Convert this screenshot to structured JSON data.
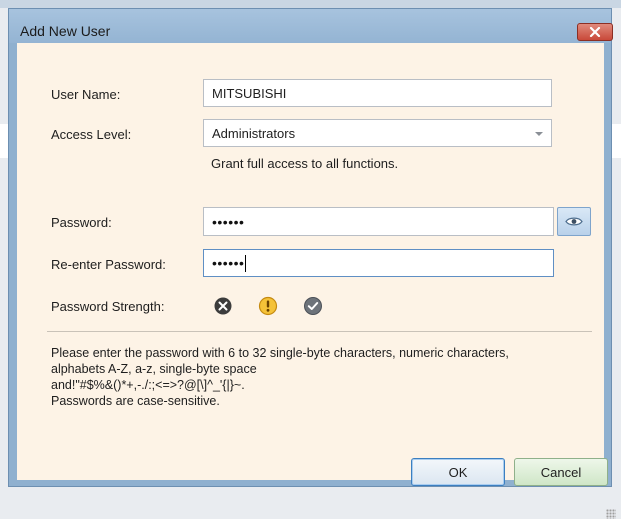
{
  "window": {
    "title": "Add New User",
    "close_icon": "close-x-icon"
  },
  "form": {
    "user_name_label": "User Name:",
    "user_name_value": "MITSUBISHI",
    "access_level_label": "Access Level:",
    "access_level_value": "Administrators",
    "access_level_hint": "Grant full access to all functions.",
    "password_label": "Password:",
    "password_value": "••••••",
    "reenter_label": "Re-enter Password:",
    "reenter_value": "••••••",
    "show_password_icon": "eye-icon",
    "strength_label": "Password Strength:",
    "strength_icons": [
      "x-circle-icon",
      "warning-icon",
      "check-circle-icon"
    ]
  },
  "info_lines": [
    "Please enter the password with 6 to 32 single-byte characters, numeric characters,",
    "alphabets A-Z, a-z, single-byte space",
    "and!\"#$%&()*+,-./:;<=>?@[\\]^_'{|}~.",
    "Passwords are case-sensitive."
  ],
  "buttons": {
    "ok": "OK",
    "cancel": "Cancel"
  },
  "colors": {
    "title_bar": "#9bb9d7",
    "client_bg": "#fdf3e6",
    "close_button": "#c9493a",
    "ok_border": "#3c7fc0",
    "cancel_bg": "#cfe6c7"
  }
}
